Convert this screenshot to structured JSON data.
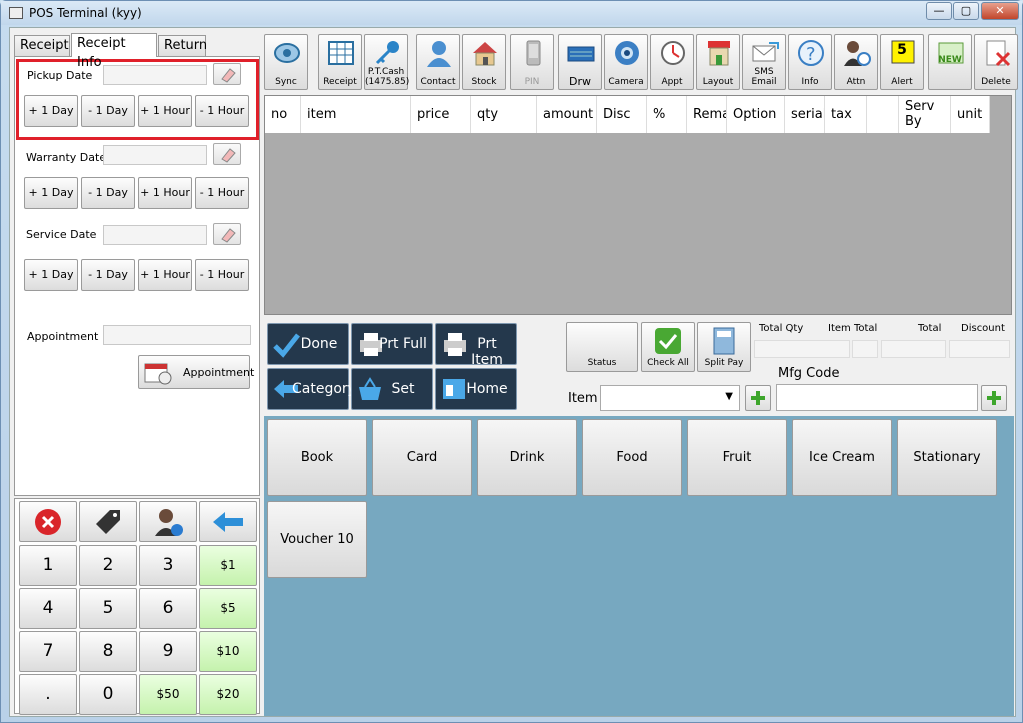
{
  "window": {
    "title": "POS Terminal (kyy)",
    "min": "—",
    "max": "▢",
    "close": "✕"
  },
  "tabs": [
    {
      "label": "Receipt"
    },
    {
      "label": "Receipt Info"
    },
    {
      "label": "Return"
    }
  ],
  "receipt_info": {
    "pickup_label": "Pickup Date",
    "warranty_label": "Warranty Date",
    "service_label": "Service Date",
    "appointment_label": "Appointment",
    "appointment_button": "Appointment",
    "date_buttons": [
      "+ 1 Day",
      "- 1 Day",
      "+ 1 Hour",
      "- 1 Hour"
    ]
  },
  "keypad": {
    "digits": [
      "1",
      "2",
      "3",
      "4",
      "5",
      "6",
      "7",
      "8",
      "9",
      ".",
      "0"
    ],
    "cash": [
      "$1",
      "$5",
      "$10",
      "$50",
      "$20"
    ]
  },
  "toolbar": [
    {
      "label": "Sync",
      "icon": "sync-icon"
    },
    {
      "label": "Receipt",
      "icon": "receipt-icon"
    },
    {
      "label": "P.T.Cash (1475.85)",
      "icon": "key-icon"
    },
    {
      "label": "Contact",
      "icon": "contact-icon"
    },
    {
      "label": "Stock",
      "icon": "stock-icon"
    },
    {
      "label": "PIN",
      "icon": "pin-icon"
    },
    {
      "label": "Drw",
      "icon": "drawer-icon"
    },
    {
      "label": "Camera",
      "icon": "camera-icon"
    },
    {
      "label": "Appt",
      "icon": "appointment-icon"
    },
    {
      "label": "Layout",
      "icon": "shop-icon"
    },
    {
      "label": "SMS Email",
      "icon": "email-icon"
    },
    {
      "label": "Info",
      "icon": "info-icon"
    },
    {
      "label": "Attn",
      "icon": "attendance-icon"
    },
    {
      "label": "Alert",
      "icon": "alert-icon",
      "badge": "5"
    },
    {
      "label": "",
      "icon": "new-icon",
      "badge": "NEW"
    },
    {
      "label": "Delete",
      "icon": "delete-icon"
    }
  ],
  "grid": {
    "columns": [
      "no",
      "item",
      "price",
      "qty",
      "amount",
      "Disc",
      "%",
      "Remarks",
      "Option",
      "serial",
      "tax",
      "",
      "Serv By",
      "unit"
    ]
  },
  "actions": {
    "done": "Done",
    "prt_full": "Prt Full",
    "prt_item": "Prt Item",
    "category": "Category",
    "set": "Set",
    "home": "Home"
  },
  "status_buttons": {
    "status": "Status",
    "check_all": "Check All",
    "split_pay": "Split Pay"
  },
  "totals": {
    "total_qty": "Total Qty",
    "item_total": "Item Total",
    "total": "Total",
    "discount": "Discount"
  },
  "item_entry": {
    "item_label": "Item",
    "mfg_label": "Mfg Code"
  },
  "categories": [
    "Book",
    "Card",
    "Drink",
    "Food",
    "Fruit",
    "Ice Cream",
    "Stationary",
    "Voucher 10"
  ],
  "colors": {
    "accent_dark": "#24384c",
    "category_area": "#77a8c0",
    "cash_button": "#c5f2ad",
    "highlight": "#e0202a"
  }
}
